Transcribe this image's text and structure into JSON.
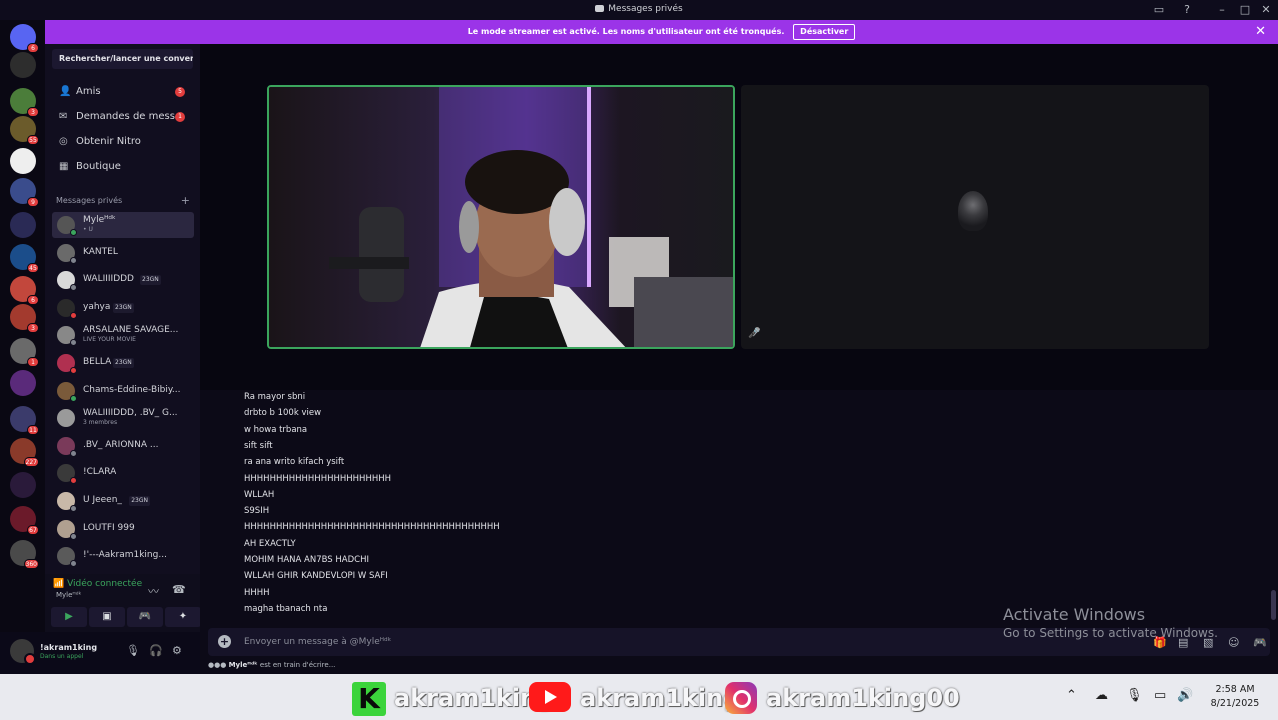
{
  "window": {
    "title": "Messages privés"
  },
  "banner": {
    "text": "Le mode streamer est activé. Les noms d'utilisateur ont été tronqués.",
    "button": "Désactiver"
  },
  "rail_badges": [
    "6",
    "",
    "3",
    "55",
    "",
    "9",
    "",
    "45",
    "6",
    "3",
    "1",
    "",
    "11",
    "227",
    "",
    "67",
    "360"
  ],
  "sidebar": {
    "search_label": "Rechercher/lancer une convers...",
    "nav": [
      {
        "label": "Amis",
        "badge": "5",
        "icon": "friends-icon"
      },
      {
        "label": "Demandes de mess...",
        "badge": "1",
        "icon": "mail-icon"
      },
      {
        "label": "Obtenir Nitro",
        "badge": "",
        "icon": "nitro-icon"
      },
      {
        "label": "Boutique",
        "badge": "",
        "icon": "shop-icon"
      }
    ],
    "dm_header": "Messages privés",
    "dms": [
      {
        "name": "Myleᴴᵈᵏ",
        "sub": "• U",
        "status": "#3ba55d",
        "tag": ""
      },
      {
        "name": "KANTEL",
        "sub": "",
        "status": "#80848e",
        "tag": ""
      },
      {
        "name": "WALIIIIDDD",
        "sub": "",
        "status": "#80848e",
        "tag": "23GN"
      },
      {
        "name": "yahya",
        "sub": "",
        "status": "#e23d3d",
        "tag": "23GN"
      },
      {
        "name": "ARSALANE SAVAGE...",
        "sub": "LIVE YOUR MOVIE",
        "status": "#80848e",
        "tag": ""
      },
      {
        "name": "BELLA",
        "sub": "",
        "status": "#e23d3d",
        "tag": "23GN"
      },
      {
        "name": "Chams-Eddine-Bibiy...",
        "sub": "",
        "status": "#3ba55d",
        "tag": ""
      },
      {
        "name": "WALIIIIDDD, .BV_ G...",
        "sub": "3 membres",
        "status": "",
        "tag": ""
      },
      {
        "name": ".BV_ ARIONNA ...",
        "sub": "",
        "status": "#80848e",
        "tag": ""
      },
      {
        "name": "!CLARA",
        "sub": "",
        "status": "#e23d3d",
        "tag": ""
      },
      {
        "name": "U Jeeen_",
        "sub": "",
        "status": "#80848e",
        "tag": "23GN"
      },
      {
        "name": "LOUTFI 999",
        "sub": "",
        "status": "#80848e",
        "tag": ""
      },
      {
        "name": "!'---Aakram1king...",
        "sub": "",
        "status": "#80848e",
        "tag": ""
      }
    ]
  },
  "voice": {
    "status": "Vidéo connectée",
    "user": "Myleᴴᵈᵏ"
  },
  "user": {
    "name": "!akram1king",
    "status": "Dans un appel"
  },
  "messages": [
    "Ra mayor sbni",
    "drbto b 100k view",
    "w howa trbana",
    "sift sift",
    "ra ana writo kifach ysift",
    "HHHHHHHHHHHHHHHHHHHHHHH",
    "WLLAH",
    "S9SIH",
    "HHHHHHHHHHHHHHHHHHHHHHHHHHHHHHHHHHHHHHHH",
    "AH EXACTLY",
    "MOHIM HANA AN7BS HADCHI",
    "WLLAH GHIR KANDEVLOPI W SAFI",
    "HHHH",
    "magha tbanach nta"
  ],
  "composer": {
    "placeholder": "Envoyer un message à @Myleᴴᵈᵏ"
  },
  "typing": {
    "name": "Myleᴴᵈᵏ",
    "text": " est en train d'écrire..."
  },
  "watermark": {
    "line1": "Activate Windows",
    "line2": "Go to Settings to activate Windows."
  },
  "overlay": {
    "k": "K",
    "t1": "akram1king",
    "t2": "akram1king",
    "t3": "akram1king00"
  },
  "clock": {
    "time": "2:58 AM",
    "date": "8/21/2025"
  },
  "colors": {
    "accent": "#9b34e8",
    "online": "#3ba55d",
    "dnd": "#e23d3d",
    "badge": "#e23d3d"
  }
}
